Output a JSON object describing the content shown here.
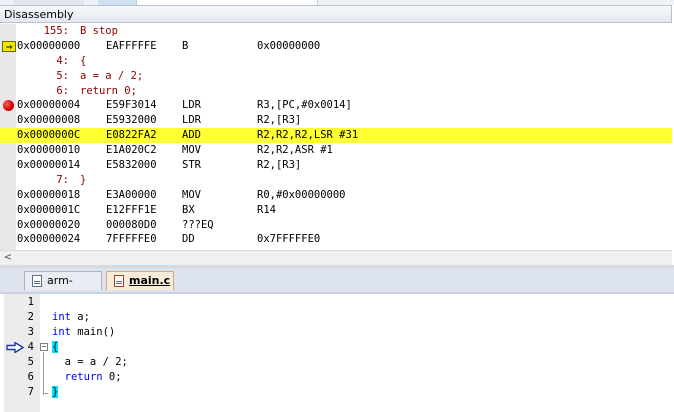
{
  "window": {
    "title": "Disassembly"
  },
  "disassembly": {
    "lines": [
      {
        "kind": "src",
        "num": "155:",
        "text": "B stop"
      },
      {
        "kind": "asm",
        "addr": "0x00000000",
        "code": "EAFFFFFE",
        "mn": "B",
        "op": "0x00000000",
        "marker": "pc-arrow"
      },
      {
        "kind": "src",
        "num": "4:",
        "text": "{"
      },
      {
        "kind": "src",
        "num": "5:",
        "text": "a = a / 2;"
      },
      {
        "kind": "src",
        "num": "6:",
        "text": "return 0;"
      },
      {
        "kind": "asm",
        "addr": "0x00000004",
        "code": "E59F3014",
        "mn": "LDR",
        "op": "R3,[PC,#0x0014]",
        "marker": "breakpoint"
      },
      {
        "kind": "asm",
        "addr": "0x00000008",
        "code": "E5932000",
        "mn": "LDR",
        "op": "R2,[R3]"
      },
      {
        "kind": "asm",
        "addr": "0x0000000C",
        "code": "E0822FA2",
        "mn": "ADD",
        "op": "R2,R2,R2,LSR #31",
        "highlight": true
      },
      {
        "kind": "asm",
        "addr": "0x00000010",
        "code": "E1A020C2",
        "mn": "MOV",
        "op": "R2,R2,ASR #1"
      },
      {
        "kind": "asm",
        "addr": "0x00000014",
        "code": "E5832000",
        "mn": "STR",
        "op": "R2,[R3]"
      },
      {
        "kind": "src",
        "num": "7:",
        "text": "}"
      },
      {
        "kind": "asm",
        "addr": "0x00000018",
        "code": "E3A00000",
        "mn": "MOV",
        "op": "R0,#0x00000000"
      },
      {
        "kind": "asm",
        "addr": "0x0000001C",
        "code": "E12FFF1E",
        "mn": "BX",
        "op": "R14"
      },
      {
        "kind": "asm",
        "addr": "0x00000020",
        "code": "000080D0",
        "mn": "???EQ",
        "op": ""
      },
      {
        "kind": "asm",
        "addr": "0x00000024",
        "code": "7FFFFFE0",
        "mn": "DD",
        "op": "0x7FFFFFE0"
      }
    ],
    "scroll_left": "<"
  },
  "editor": {
    "tabs": [
      {
        "label": "arm-asm.s",
        "active": false
      },
      {
        "label": "main.c",
        "active": true
      }
    ],
    "lines": [
      {
        "num": "1",
        "code": ""
      },
      {
        "num": "2",
        "code": "int a;"
      },
      {
        "num": "3",
        "code": "int main()"
      },
      {
        "num": "4",
        "code": "{"
      },
      {
        "num": "5",
        "code": "  a = a / 2;"
      },
      {
        "num": "6",
        "code": "  return 0;"
      },
      {
        "num": "7",
        "code": "}"
      }
    ],
    "current_line": "4",
    "fold_symbol": "−"
  },
  "colors": {
    "highlight": "#ffff33",
    "source_text": "#8b0000",
    "keyword": "#0000ff",
    "brace_match": "#00e5ff",
    "breakpoint": "#d00000"
  }
}
